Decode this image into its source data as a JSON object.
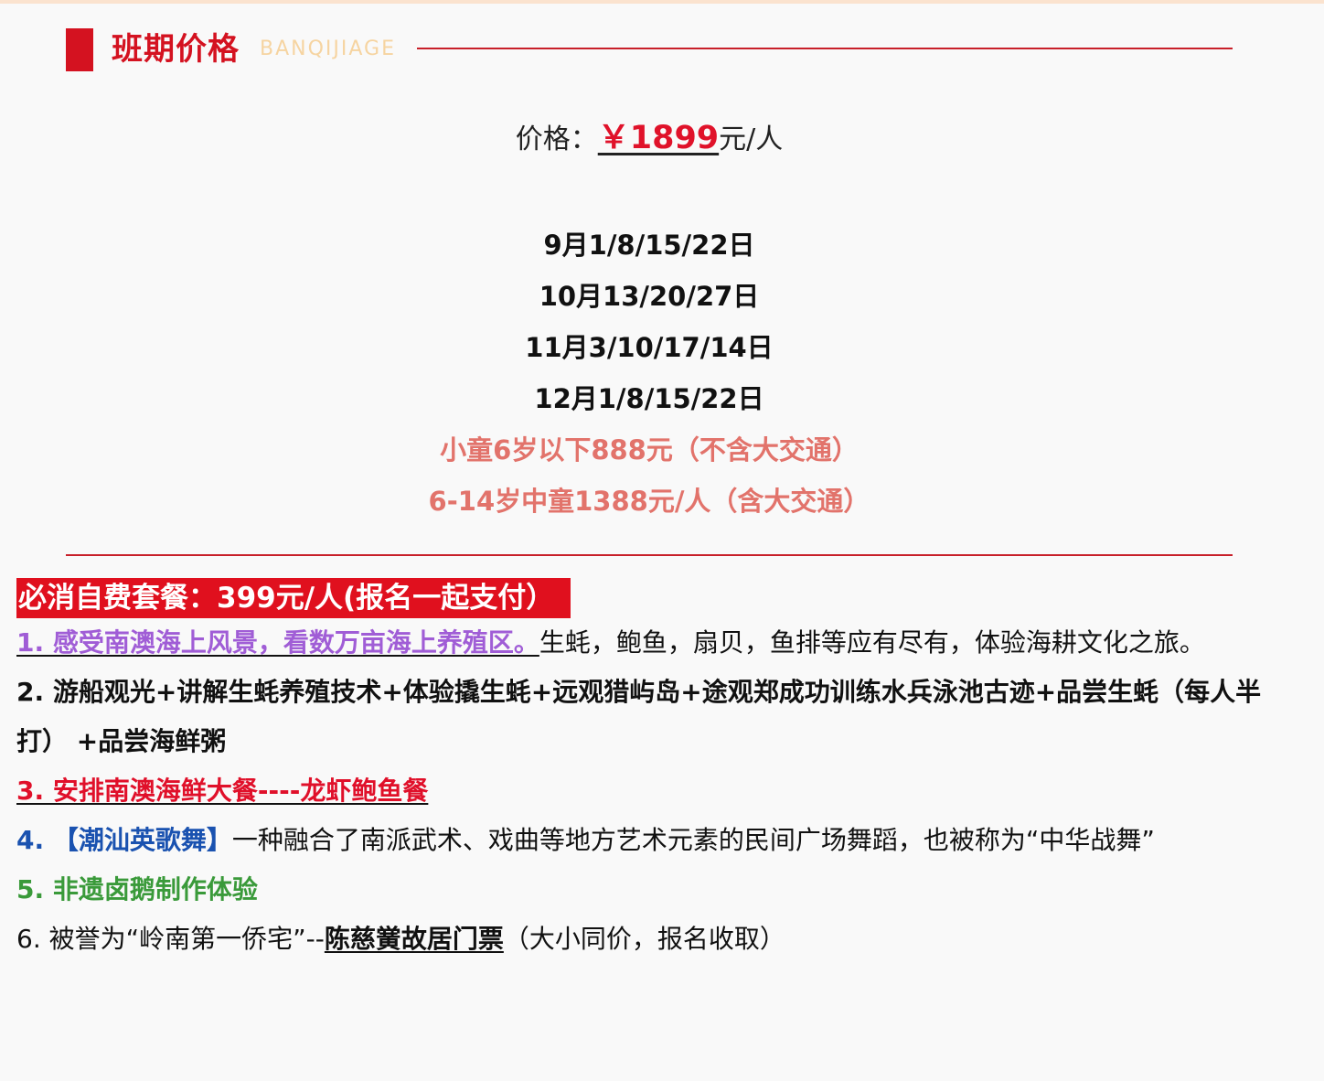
{
  "section": {
    "title": "班期价格",
    "subtitle": "BANQIJIAGE"
  },
  "price": {
    "label": "价格：",
    "amount": "￥1899",
    "unit": "元/人"
  },
  "dates": [
    "9月1/8/15/22日",
    "10月13/20/27日",
    "11月3/10/17/14日",
    "12月1/8/15/22日"
  ],
  "children": [
    "小童6岁以下888元（不含大交通）",
    "6-14岁中童1388元/人（含大交通）"
  ],
  "package": {
    "banner": "必消自费套餐：399元/人(报名一起支付）",
    "item1": {
      "highlight": "1. 感受南澳海上风景，看数万亩海上养殖区。",
      "rest": "生蚝，鲍鱼，扇贝，鱼排等应有尽有，体验海耕文化之旅。"
    },
    "item2": {
      "text": "2. 游船观光+讲解生蚝养殖技术+体验撬生蚝+远观猎屿岛+途观郑成功训练水兵泳池古迹+品尝生蚝（每人半打） +品尝海鲜粥"
    },
    "item3": {
      "text": "3. 安排南澳海鲜大餐----龙虾鲍鱼餐"
    },
    "item4": {
      "highlight": "4. 【潮汕英歌舞】",
      "rest": "一种融合了南派武术、戏曲等地方艺术元素的民间广场舞蹈，也被称为“中华战舞”"
    },
    "item5": {
      "text": "5. 非遗卤鹅制作体验"
    },
    "item6": {
      "prefix": "6. 被誉为“岭南第一侨宅”--",
      "highlight": "陈慈黉故居门票",
      "suffix": "（大小同价，报名收取）"
    }
  },
  "colors": {
    "accent_red": "#d41220",
    "subtitle_gold": "#f6d4a1",
    "price_red": "#e0122a",
    "kid_salmon": "#e2736b",
    "purple": "#a05dd6",
    "blue": "#1a52b0",
    "green": "#3a9a3a"
  }
}
